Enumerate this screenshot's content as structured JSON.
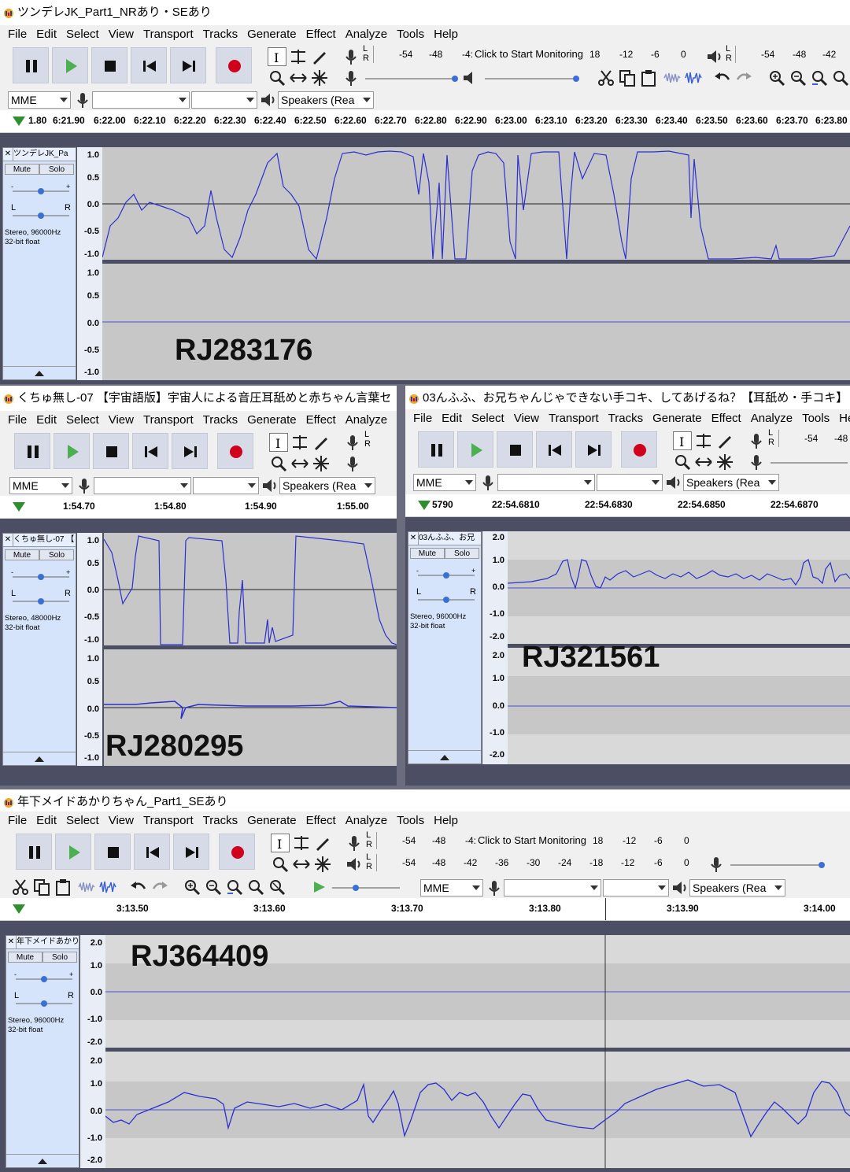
{
  "menus": [
    "File",
    "Edit",
    "Select",
    "View",
    "Transport",
    "Tracks",
    "Generate",
    "Effect",
    "Analyze",
    "Tools",
    "Help"
  ],
  "device": {
    "host": "MME",
    "output": "Speakers (Rea"
  },
  "meter": {
    "record_scale": [
      "-54",
      "-48",
      "-4:"
    ],
    "monitor_text": "Click to Start Monitoring",
    "record_scale_right": [
      "18",
      "-12",
      "-6",
      "0"
    ],
    "play_scale": [
      "-54",
      "-48",
      "-42"
    ],
    "play_scale_full": [
      "-54",
      "-48",
      "-42",
      "-36",
      "-30",
      "-24",
      "-18",
      "-12",
      "-6",
      "0"
    ],
    "lr": [
      "L",
      "R"
    ]
  },
  "panel": {
    "mute": "Mute",
    "solo": "Solo",
    "lr_left": "L",
    "lr_right": "R"
  },
  "windows": [
    {
      "title": "ツンデレJK_Part1_NRあり・SEあり",
      "track_name": "ツンデレJK_Pa",
      "format": "Stereo, 96000Hz",
      "bits": "32-bit float",
      "ruler": [
        "1.80",
        "6:21.90",
        "6:22.00",
        "6:22.10",
        "6:22.20",
        "6:22.30",
        "6:22.40",
        "6:22.50",
        "6:22.60",
        "6:22.70",
        "6:22.80",
        "6:22.90",
        "6:23.00",
        "6:23.10",
        "6:23.20",
        "6:23.30",
        "6:23.40",
        "6:23.50",
        "6:23.60",
        "6:23.70",
        "6:23.80"
      ],
      "vscale": [
        "1.0",
        "0.5",
        "0.0",
        "-0.5",
        "-1.0"
      ],
      "overlay": "RJ283176"
    },
    {
      "title": "くちゅ無し-07 【宇宙語版】宇宙人による音圧耳舐めと赤ちゃん言葉セ",
      "track_name": "くちゅ無し-07 【",
      "format": "Stereo, 48000Hz",
      "bits": "32-bit float",
      "ruler": [
        "1:54.70",
        "1:54.80",
        "1:54.90",
        "1:55.00"
      ],
      "vscale": [
        "1.0",
        "0.5",
        "0.0",
        "-0.5",
        "-1.0"
      ],
      "overlay": "RJ280295"
    },
    {
      "title": "03んふふ、お兄ちゃんじゃできない手コキ、してあげるね？【耳舐め・手コキ】",
      "track_name": "03んふふ、お兄",
      "format": "Stereo, 96000Hz",
      "bits": "32-bit float",
      "ruler": [
        "5790",
        "22:54.6810",
        "22:54.6830",
        "22:54.6850",
        "22:54.6870"
      ],
      "vscale": [
        "2.0",
        "1.0",
        "0.0",
        "-1.0",
        "-2.0"
      ],
      "overlay": "RJ321561"
    },
    {
      "title": "年下メイドあかりちゃん_Part1_SEあり",
      "track_name": "年下メイドあかり",
      "format": "Stereo, 96000Hz",
      "bits": "32-bit float",
      "ruler": [
        "3:13.50",
        "3:13.60",
        "3:13.70",
        "3:13.80",
        "3:13.90",
        "3:14.00"
      ],
      "vscale": [
        "2.0",
        "1.0",
        "0.0",
        "-1.0",
        "-2.0"
      ],
      "overlay": "RJ364409"
    }
  ]
}
